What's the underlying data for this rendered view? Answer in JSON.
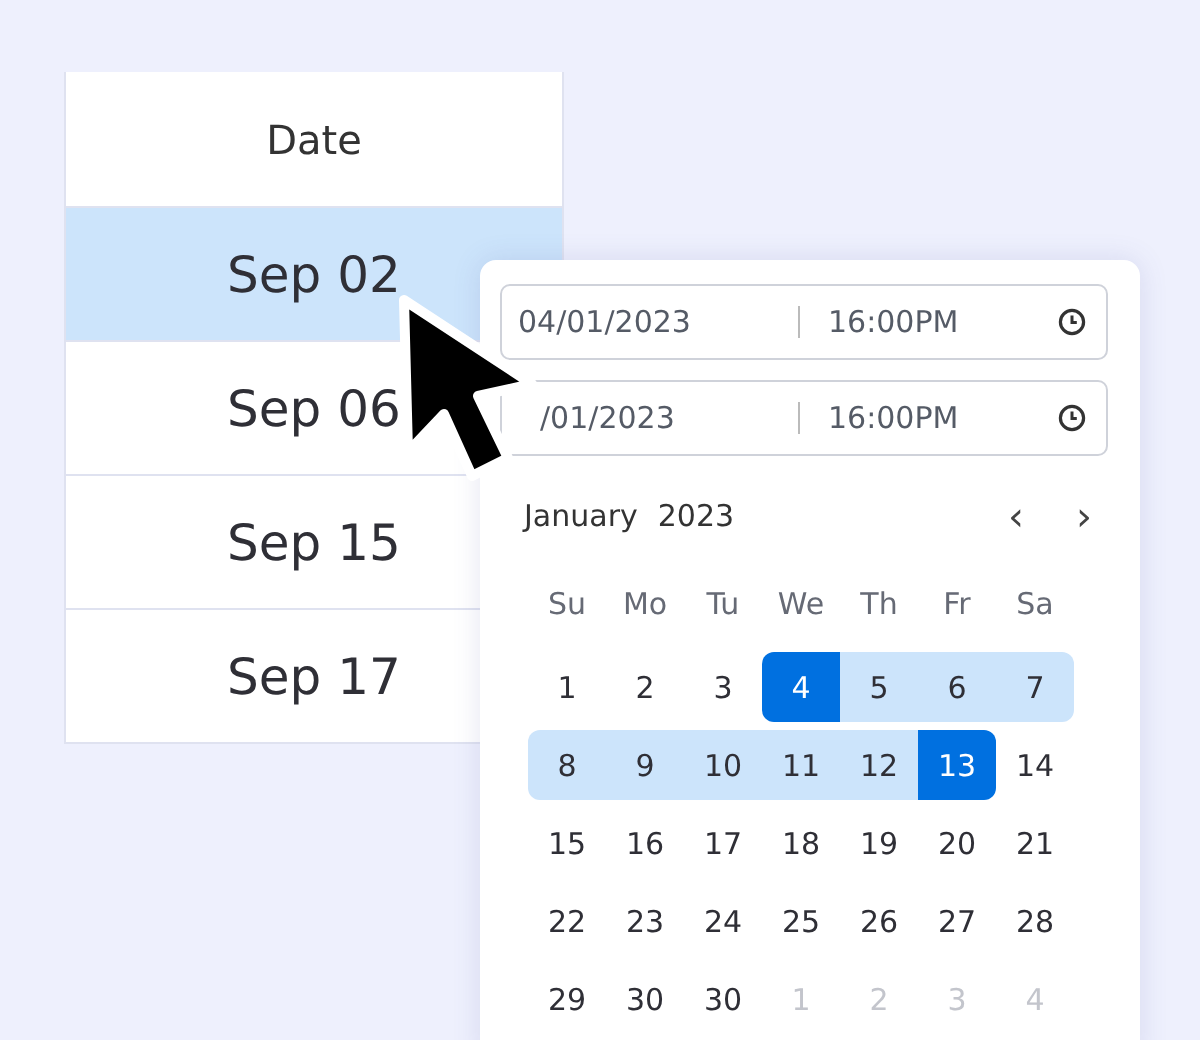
{
  "table": {
    "header": "Date",
    "rows": [
      {
        "label": "Sep 02",
        "selected": true
      },
      {
        "label": "Sep 06",
        "selected": false
      },
      {
        "label": "Sep 15",
        "selected": false
      },
      {
        "label": "Sep 17",
        "selected": false
      }
    ]
  },
  "picker": {
    "fields": [
      {
        "date": "04/01/2023",
        "time": "16:00PM"
      },
      {
        "date": "/01/2023",
        "time": "16:00PM"
      }
    ],
    "month": "January",
    "year": "2023",
    "prev": "‹",
    "next": "›",
    "weekdays": [
      "Su",
      "Mo",
      "Tu",
      "We",
      "Th",
      "Fr",
      "Sa"
    ],
    "weeks": [
      [
        {
          "label": "1",
          "selected": false,
          "in_range": false,
          "outside": false
        },
        {
          "label": "2",
          "selected": false,
          "in_range": false,
          "outside": false
        },
        {
          "label": "3",
          "selected": false,
          "in_range": false,
          "outside": false
        },
        {
          "label": "4",
          "selected": true,
          "in_range": true,
          "outside": false
        },
        {
          "label": "5",
          "selected": false,
          "in_range": true,
          "outside": false
        },
        {
          "label": "6",
          "selected": false,
          "in_range": true,
          "outside": false
        },
        {
          "label": "7",
          "selected": false,
          "in_range": true,
          "outside": false
        }
      ],
      [
        {
          "label": "8",
          "selected": false,
          "in_range": true,
          "outside": false
        },
        {
          "label": "9",
          "selected": false,
          "in_range": true,
          "outside": false
        },
        {
          "label": "10",
          "selected": false,
          "in_range": true,
          "outside": false
        },
        {
          "label": "11",
          "selected": false,
          "in_range": true,
          "outside": false
        },
        {
          "label": "12",
          "selected": false,
          "in_range": true,
          "outside": false
        },
        {
          "label": "13",
          "selected": true,
          "in_range": true,
          "outside": false
        },
        {
          "label": "14",
          "selected": false,
          "in_range": false,
          "outside": false
        }
      ],
      [
        {
          "label": "15",
          "selected": false,
          "in_range": false,
          "outside": false
        },
        {
          "label": "16",
          "selected": false,
          "in_range": false,
          "outside": false
        },
        {
          "label": "17",
          "selected": false,
          "in_range": false,
          "outside": false
        },
        {
          "label": "18",
          "selected": false,
          "in_range": false,
          "outside": false
        },
        {
          "label": "19",
          "selected": false,
          "in_range": false,
          "outside": false
        },
        {
          "label": "20",
          "selected": false,
          "in_range": false,
          "outside": false
        },
        {
          "label": "21",
          "selected": false,
          "in_range": false,
          "outside": false
        }
      ],
      [
        {
          "label": "22",
          "selected": false,
          "in_range": false,
          "outside": false
        },
        {
          "label": "23",
          "selected": false,
          "in_range": false,
          "outside": false
        },
        {
          "label": "24",
          "selected": false,
          "in_range": false,
          "outside": false
        },
        {
          "label": "25",
          "selected": false,
          "in_range": false,
          "outside": false
        },
        {
          "label": "26",
          "selected": false,
          "in_range": false,
          "outside": false
        },
        {
          "label": "27",
          "selected": false,
          "in_range": false,
          "outside": false
        },
        {
          "label": "28",
          "selected": false,
          "in_range": false,
          "outside": false
        }
      ],
      [
        {
          "label": "29",
          "selected": false,
          "in_range": false,
          "outside": false
        },
        {
          "label": "30",
          "selected": false,
          "in_range": false,
          "outside": false
        },
        {
          "label": "30",
          "selected": false,
          "in_range": false,
          "outside": false
        },
        {
          "label": "1",
          "selected": false,
          "in_range": false,
          "outside": true
        },
        {
          "label": "2",
          "selected": false,
          "in_range": false,
          "outside": true
        },
        {
          "label": "3",
          "selected": false,
          "in_range": false,
          "outside": true
        },
        {
          "label": "4",
          "selected": false,
          "in_range": false,
          "outside": true
        }
      ]
    ]
  }
}
